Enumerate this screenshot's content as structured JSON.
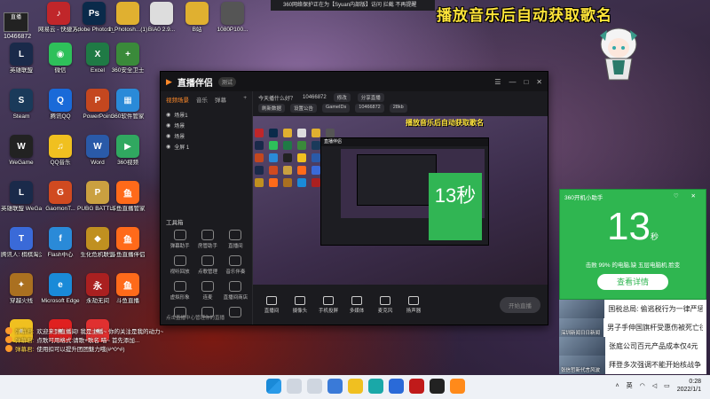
{
  "top_strip": "360网络保护正在为【Syuan内部版】访问 拦截 不再提醒",
  "overlay_title": "播放音乐后自动获取歌名",
  "streamer": {
    "logo": "直播",
    "uid": "10466872"
  },
  "desktop_icons": [
    {
      "label": "网易云 - 快捷方式",
      "color": "#c0262a",
      "glyph": "♪"
    },
    {
      "label": "Adobe Photosh...",
      "color": "#0a2a4a",
      "glyph": "Ps"
    },
    {
      "label": "1_Photosh...(1)",
      "color": "#e0b030",
      "glyph": ""
    },
    {
      "label": "BIA0 2.9...",
      "color": "#ddd",
      "glyph": ""
    },
    {
      "label": "B站",
      "color": "#e0b030",
      "glyph": ""
    },
    {
      "label": "1080P100...",
      "color": "#555",
      "glyph": ""
    },
    {
      "label": "英雄联盟",
      "color": "#1a2a4a",
      "glyph": "L"
    },
    {
      "label": "微信",
      "color": "#2ec05a",
      "glyph": "◉"
    },
    {
      "label": "Excel",
      "color": "#1f7a45",
      "glyph": "X"
    },
    {
      "label": "360安全卫士",
      "color": "#3a8a3a",
      "glyph": "+"
    },
    {
      "label": "Steam",
      "color": "#1a3a5a",
      "glyph": "S"
    },
    {
      "label": "腾讯QQ",
      "color": "#1a6ad8",
      "glyph": "Q"
    },
    {
      "label": "PowerPoint",
      "color": "#c4471f",
      "glyph": "P"
    },
    {
      "label": "360软件管家",
      "color": "#2a8ad8",
      "glyph": "▦"
    },
    {
      "label": "WeGame",
      "color": "#222",
      "glyph": "W"
    },
    {
      "label": "QQ音乐",
      "color": "#f0c020",
      "glyph": "♫"
    },
    {
      "label": "Word",
      "color": "#2a5aa8",
      "glyph": "W"
    },
    {
      "label": "360视频",
      "color": "#30a860",
      "glyph": "▶"
    },
    {
      "label": "英雄联盟 WeGame版",
      "color": "#1a2a4a",
      "glyph": "L"
    },
    {
      "label": "GaomonT...",
      "color": "#d04a20",
      "glyph": "G"
    },
    {
      "label": "PUBG BATTLEGR...",
      "color": "#caa040",
      "glyph": "P"
    },
    {
      "label": "斗鱼直播管家",
      "color": "#ff6a1a",
      "glyph": "鱼"
    },
    {
      "label": "腾讯人: 棋棋淘汰赛",
      "color": "#3a6ad8",
      "glyph": "T"
    },
    {
      "label": "Flash中心",
      "color": "#2a8ad8",
      "glyph": "f"
    },
    {
      "label": "生化危机联盟",
      "color": "#c09020",
      "glyph": "◆"
    },
    {
      "label": "斗鱼直播伴侣",
      "color": "#ff6a1a",
      "glyph": "鱼"
    },
    {
      "label": "穿越火线",
      "color": "#aa7020",
      "glyph": "✦"
    },
    {
      "label": "Microsoft Edge",
      "color": "#1a8ad8",
      "glyph": "e"
    },
    {
      "label": "永劫无间",
      "color": "#aa2020",
      "glyph": "永"
    },
    {
      "label": "斗鱼直播",
      "color": "#ff6a1a",
      "glyph": "鱼"
    },
    {
      "label": "",
      "color": "#f0c020",
      "glyph": "●"
    },
    {
      "label": "",
      "color": "#e02020",
      "glyph": "●"
    },
    {
      "label": "",
      "color": "#e03030",
      "glyph": "●"
    }
  ],
  "app": {
    "brand": "直播伴侣",
    "brand_tag": "测试",
    "window_controls": [
      "☰",
      "—",
      "□",
      "✕"
    ],
    "sidebar_tabs": [
      "视频场景",
      "音乐",
      "弹幕"
    ],
    "scenes": [
      "场景1",
      "场景",
      "场景",
      "全屏 1"
    ],
    "tools_title": "工具箱",
    "tools": [
      "弹幕助手",
      "房管助手",
      "直播间",
      "视听回放",
      "点歌管理",
      "音乐伴奏",
      "虚拟形象",
      "连麦",
      "直播间商店",
      "",
      "",
      ""
    ],
    "sidebar_foot": "点击直播中心管理你的直播",
    "room": {
      "line1": "今天播什么好？",
      "room_id": "10466872",
      "edit": "修改",
      "tag": "分享直播",
      "pills": [
        "刷新数据",
        "设置公告",
        "GameIDs",
        "10466872",
        "28kb"
      ]
    },
    "preview_title": "播放音乐后自动获取歌名",
    "bottom_tools": [
      "直播间",
      "摄像头",
      "手机投屏",
      "多媒体",
      "麦克风",
      "扬声器"
    ],
    "go_live": "开始直播"
  },
  "popup": {
    "title": "360开机小助手",
    "controls": "♡ ✕",
    "value": "13",
    "unit": "秒",
    "sub": "击败 99% 的电脑,缺 五层电脑机 脸变",
    "button": "查看详情",
    "mini_title": "13秒"
  },
  "news": [
    {
      "thumb": "",
      "text": "国税总局: 偷逃税行为一律严惩"
    },
    {
      "thumb": "深圳新闻日日新闻",
      "text": "男子手伸国旗杆受惠伤被死亡往"
    },
    {
      "thumb": "",
      "text": "张庭公司百元产品成本仅4元"
    },
    {
      "thumb": "张信哲新代言风波",
      "text": "拜登多次强调不能开始核战争"
    }
  ],
  "chat": [
    {
      "name": "弹幕君:",
      "text": "欢迎来到直播间! 我是主播~ 你的关注是我的动力~"
    },
    {
      "name": "弹幕君:",
      "text": "点歌可用格式:请歌+歌名 喵~ 首先添加..."
    },
    {
      "name": "弹幕君:",
      "text": "使用扣可以提升团团魅力哦(#^0^#)"
    }
  ],
  "taskbar": {
    "lang": "英",
    "time": "0:28",
    "date": "2022/1/1"
  }
}
